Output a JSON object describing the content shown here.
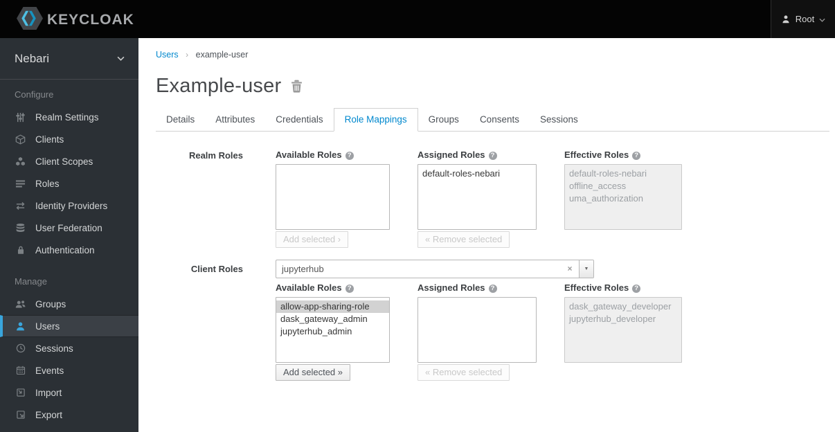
{
  "header": {
    "logo_text": "KEYCLOAK",
    "user_menu": {
      "name": "Root"
    }
  },
  "sidebar": {
    "realm_name": "Nebari",
    "sections": [
      {
        "label": "Configure",
        "items": [
          {
            "icon": "sliders-icon",
            "label": "Realm Settings"
          },
          {
            "icon": "cube-icon",
            "label": "Clients"
          },
          {
            "icon": "cubes-icon",
            "label": "Client Scopes"
          },
          {
            "icon": "list-icon",
            "label": "Roles"
          },
          {
            "icon": "exchange-icon",
            "label": "Identity Providers"
          },
          {
            "icon": "database-icon",
            "label": "User Federation"
          },
          {
            "icon": "lock-icon",
            "label": "Authentication"
          }
        ]
      },
      {
        "label": "Manage",
        "items": [
          {
            "icon": "users-icon",
            "label": "Groups"
          },
          {
            "icon": "user-icon",
            "label": "Users",
            "active": true
          },
          {
            "icon": "clock-icon",
            "label": "Sessions"
          },
          {
            "icon": "calendar-icon",
            "label": "Events"
          },
          {
            "icon": "import-icon",
            "label": "Import"
          },
          {
            "icon": "export-icon",
            "label": "Export"
          }
        ]
      }
    ]
  },
  "breadcrumb": {
    "link": "Users",
    "separator": "›",
    "current": "example-user"
  },
  "page": {
    "title": "Example-user"
  },
  "tabs": {
    "items": [
      "Details",
      "Attributes",
      "Credentials",
      "Role Mappings",
      "Groups",
      "Consents",
      "Sessions"
    ],
    "active": "Role Mappings"
  },
  "role_mappings": {
    "realm": {
      "row_label": "Realm Roles",
      "available": {
        "label": "Available Roles",
        "options": [],
        "button_label": "Add selected ›",
        "button_enabled": false
      },
      "assigned": {
        "label": "Assigned Roles",
        "options": [
          "default-roles-nebari"
        ],
        "button_label": "« Remove selected",
        "button_enabled": false
      },
      "effective": {
        "label": "Effective Roles",
        "options": [
          "default-roles-nebari",
          "offline_access",
          "uma_authorization"
        ]
      }
    },
    "client": {
      "row_label": "Client Roles",
      "selected_client": "jupyterhub",
      "available": {
        "label": "Available Roles",
        "options": [
          "allow-app-sharing-role",
          "dask_gateway_admin",
          "jupyterhub_admin"
        ],
        "selected_option": "allow-app-sharing-role",
        "button_label": "Add selected »",
        "button_enabled": true
      },
      "assigned": {
        "label": "Assigned Roles",
        "options": [],
        "button_label": "« Remove selected",
        "button_enabled": false
      },
      "effective": {
        "label": "Effective Roles",
        "options": [
          "dask_gateway_developer",
          "jupyterhub_developer"
        ]
      }
    }
  },
  "glyphs": {
    "help": "?",
    "clear": "×",
    "dropdown_arrow": "▼"
  },
  "colors": {
    "accent_blue": "#0088ce",
    "nav_active_blue": "#39a5dc",
    "topbar": "#040404",
    "sidebar": "#2b3035"
  }
}
